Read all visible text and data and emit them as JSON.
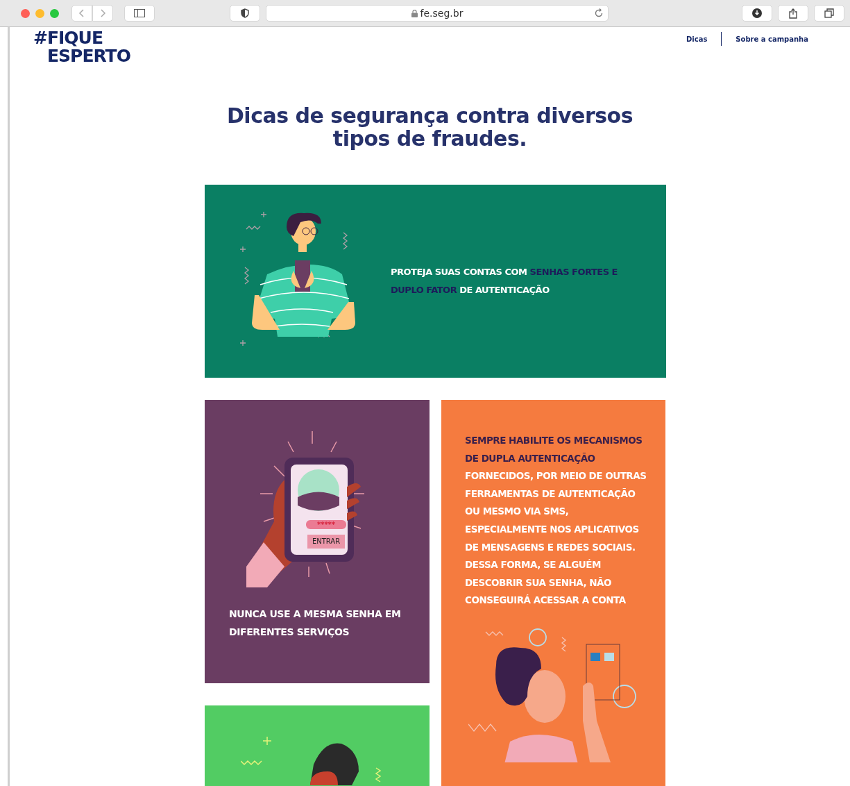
{
  "browser": {
    "url": "fe.seg.br"
  },
  "header": {
    "logo_lines": [
      "#FIQUE",
      "ESPERTO"
    ],
    "nav": [
      {
        "label": "Dicas"
      },
      {
        "label": "Sobre a campanha"
      }
    ]
  },
  "heading": "Dicas de segurança contra diversos tipos de fraudes.",
  "cards": [
    {
      "kind": "wide",
      "color": "#0a7f63",
      "segments": [
        {
          "text": "PROTEJA SUAS CONTAS COM ",
          "highlight": false
        },
        {
          "text": "SENHAS FORTES E DUPLO FATOR",
          "highlight": true
        },
        {
          "text": " DE AUTENTICAÇÃO",
          "highlight": false
        }
      ]
    },
    {
      "kind": "phone",
      "color": "#6a3d62",
      "phone_screen": {
        "password_mask": "*****",
        "button_label": "ENTRAR"
      },
      "segments": [
        {
          "text": "NUNCA USE A MESMA SENHA EM DIFERENTES SERVIÇOS",
          "highlight": false
        }
      ]
    },
    {
      "kind": "tall",
      "color": "#f57b3f",
      "segments": [
        {
          "text": "SEMPRE HABILITE OS MECANISMOS DE DUPLA AUTENTICAÇÃO",
          "highlight": true
        },
        {
          "text": " FORNECIDOS, POR MEIO DE OUTRAS FERRAMENTAS DE AUTENTICAÇÃO OU MESMO VIA SMS, ESPECIALMENTE NOS APLICATIVOS DE MENSAGENS E REDES SOCIAIS. DESSA FORMA, SE ALGUÉM DESCOBRIR SUA SENHA, NÃO CONSEGUIRÁ ACESSAR A CONTA",
          "highlight": false
        }
      ]
    },
    {
      "kind": "partial",
      "color": "#52cc63"
    }
  ]
}
